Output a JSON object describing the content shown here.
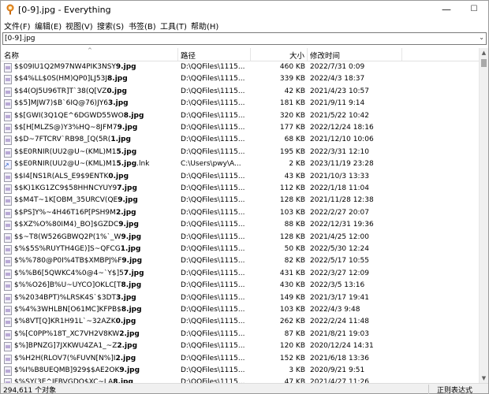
{
  "title": "[0-9].jpg - Everything",
  "window_buttons": {
    "minimize": "—",
    "maximize": "☐",
    "close": "✕"
  },
  "menu": [
    "文件(F)",
    "编辑(E)",
    "视图(V)",
    "搜索(S)",
    "书签(B)",
    "工具(T)",
    "帮助(H)"
  ],
  "search": {
    "value": "[0-9].jpg"
  },
  "columns": {
    "name": "名称",
    "path": "路径",
    "size": "大小",
    "modified": "修改时间"
  },
  "icons": {
    "app": "magnifier-icon",
    "file": "image-file-icon",
    "link": "shortcut-file-icon"
  },
  "rows": [
    {
      "name": "$$09IU1Q2M97NW4PIK3NSY",
      "bold": "9.jpg",
      "ext": "",
      "path": "D:\\QQFiles\\1115...",
      "size": "460 KB",
      "date": "2022/7/31 0:09",
      "icon": "file"
    },
    {
      "name": "$$4%LL$0S(HM)QP0]LJ53J",
      "bold": "8.jpg",
      "ext": "",
      "path": "D:\\QQFiles\\1115...",
      "size": "339 KB",
      "date": "2022/4/3 18:37",
      "icon": "file"
    },
    {
      "name": "$$4(OJ5U96TR]T`38(Q[VZ",
      "bold": "0.jpg",
      "ext": "",
      "path": "D:\\QQFiles\\1115...",
      "size": "42 KB",
      "date": "2021/4/23 10:57",
      "icon": "file"
    },
    {
      "name": "$$5]MJW7)$B`6IQ@76)JY6",
      "bold": "3.jpg",
      "ext": "",
      "path": "D:\\QQFiles\\1115...",
      "size": "181 KB",
      "date": "2021/9/11 9:14",
      "icon": "file"
    },
    {
      "name": "$$[GWI(3Q1QE^6DGWD55WO",
      "bold": "8.jpg",
      "ext": "",
      "path": "D:\\QQFiles\\1115...",
      "size": "320 KB",
      "date": "2021/5/22 10:42",
      "icon": "file"
    },
    {
      "name": "$$[H[MLZS@)Y3%HQ~8JFM7",
      "bold": "9.jpg",
      "ext": "",
      "path": "D:\\QQFiles\\1115...",
      "size": "177 KB",
      "date": "2022/12/24 18:16",
      "icon": "file"
    },
    {
      "name": "$$D~7FTCRV`RB98_[Q(5R(",
      "bold": "1.jpg",
      "ext": "",
      "path": "D:\\QQFiles\\1115...",
      "size": "68 KB",
      "date": "2021/12/10 10:06",
      "icon": "file"
    },
    {
      "name": "$$E0RNIR(UU2@U~(KML)M1",
      "bold": "5.jpg",
      "ext": "",
      "path": "D:\\QQFiles\\1115...",
      "size": "195 KB",
      "date": "2022/3/31 12:10",
      "icon": "file"
    },
    {
      "name": "$$E0RNIR(UU2@U~(KML)M1",
      "bold": "5.jpg",
      "ext": ".lnk",
      "path": "C:\\Users\\pwy\\A...",
      "size": "2 KB",
      "date": "2023/11/19 23:28",
      "icon": "link"
    },
    {
      "name": "$$I4[NS1R(ALS_E9$9ENTK",
      "bold": "0.jpg",
      "ext": "",
      "path": "D:\\QQFiles\\1115...",
      "size": "43 KB",
      "date": "2021/10/3 13:33",
      "icon": "file"
    },
    {
      "name": "$$K)1KG1ZC9$58HHNCYUY9",
      "bold": "7.jpg",
      "ext": "",
      "path": "D:\\QQFiles\\1115...",
      "size": "112 KB",
      "date": "2022/1/18 11:04",
      "icon": "file"
    },
    {
      "name": "$$M4T~1K[OBM_35URCV(QE",
      "bold": "9.jpg",
      "ext": "",
      "path": "D:\\QQFiles\\1115...",
      "size": "128 KB",
      "date": "2021/11/28 12:38",
      "icon": "file"
    },
    {
      "name": "$$PS]Y%~4H46T16P[PSH9M",
      "bold": "2.jpg",
      "ext": "",
      "path": "D:\\QQFiles\\1115...",
      "size": "103 KB",
      "date": "2022/2/27 20:07",
      "icon": "file"
    },
    {
      "name": "$$XZ%O%80IM4)_BO]$GZDC",
      "bold": "9.jpg",
      "ext": "",
      "path": "D:\\QQFiles\\1115...",
      "size": "88 KB",
      "date": "2022/12/31 19:36",
      "icon": "file"
    },
    {
      "name": "$$~T8(W526GBWQ2P(1%`_W",
      "bold": "9.jpg",
      "ext": "",
      "path": "D:\\QQFiles\\1115...",
      "size": "128 KB",
      "date": "2021/4/25 12:00",
      "icon": "file"
    },
    {
      "name": "$%$5S%RUYTH4GE)]S~QFCG",
      "bold": "1.jpg",
      "ext": "",
      "path": "D:\\QQFiles\\1115...",
      "size": "50 KB",
      "date": "2022/5/30 12:24",
      "icon": "file"
    },
    {
      "name": "$%%780@P0I%4TB$XMBPJ%F",
      "bold": "9.jpg",
      "ext": "",
      "path": "D:\\QQFiles\\1115...",
      "size": "82 KB",
      "date": "2022/5/17 10:55",
      "icon": "file"
    },
    {
      "name": "$%%B6[5QWKC4%0@4~`Y$]5",
      "bold": "7.jpg",
      "ext": "",
      "path": "D:\\QQFiles\\1115...",
      "size": "431 KB",
      "date": "2022/3/27 12:09",
      "icon": "file"
    },
    {
      "name": "$%%O26]B%U~UYCO]OKLC[T",
      "bold": "8.jpg",
      "ext": "",
      "path": "D:\\QQFiles\\1115...",
      "size": "430 KB",
      "date": "2022/3/5 13:16",
      "icon": "file"
    },
    {
      "name": "$%2034BPT)%LRSK4S`$3DT",
      "bold": "3.jpg",
      "ext": "",
      "path": "D:\\QQFiles\\1115...",
      "size": "149 KB",
      "date": "2021/3/17 19:41",
      "icon": "file"
    },
    {
      "name": "$%4%3WHLBN[O61MC]KFPB$",
      "bold": "8.jpg",
      "ext": "",
      "path": "D:\\QQFiles\\1115...",
      "size": "103 KB",
      "date": "2022/4/3 9:48",
      "icon": "file"
    },
    {
      "name": "$%8VT[Q]KR1H91L`~32AZK",
      "bold": "0.jpg",
      "ext": "",
      "path": "D:\\QQFiles\\1115...",
      "size": "262 KB",
      "date": "2022/2/24 11:48",
      "icon": "file"
    },
    {
      "name": "$%[C0PP%18T_XC7VH2V8KW",
      "bold": "2.jpg",
      "ext": "",
      "path": "D:\\QQFiles\\1115...",
      "size": "87 KB",
      "date": "2021/8/21 19:03",
      "icon": "file"
    },
    {
      "name": "$%]BPNZG]7JXKWU4ZA1_~Z",
      "bold": "2.jpg",
      "ext": "",
      "path": "D:\\QQFiles\\1115...",
      "size": "120 KB",
      "date": "2020/12/24 14:31",
      "icon": "file"
    },
    {
      "name": "$%H2H(RLOV7(%FUVN[N%]I",
      "bold": "2.jpg",
      "ext": "",
      "path": "D:\\QQFiles\\1115...",
      "size": "152 KB",
      "date": "2021/6/18 13:36",
      "icon": "file"
    },
    {
      "name": "$%I%B8UEQMB]929$$AE2OK",
      "bold": "9.jpg",
      "ext": "",
      "path": "D:\\QQFiles\\1115...",
      "size": "3 KB",
      "date": "2020/9/21 9:51",
      "icon": "file"
    },
    {
      "name": "$%SY(3E^IFBVGDQ$XC~LA",
      "bold": "8.jpg",
      "ext": "",
      "path": "D:\\QQFiles\\1115...",
      "size": "47 KB",
      "date": "2021/4/27 11:26",
      "icon": "file"
    }
  ],
  "status": {
    "count": "294,611 个对象",
    "mode": "正则表达式"
  }
}
